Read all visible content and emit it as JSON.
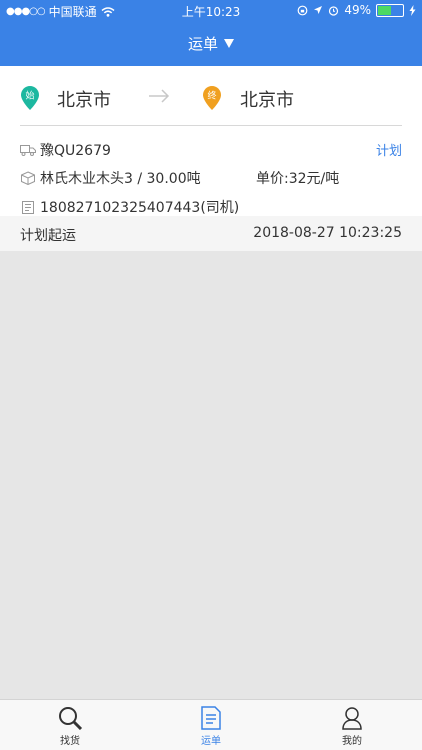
{
  "status": {
    "carrier": "中国联通",
    "time": "上午10:23",
    "battery": "49%",
    "battery_level": 0.49
  },
  "nav": {
    "title": "运单",
    "dropdown_icon": "triangle-down-icon"
  },
  "route": {
    "start_badge": "始",
    "start_city": "北京市",
    "end_badge": "终",
    "end_city": "北京市"
  },
  "order": {
    "plate": "豫QU2679",
    "plan_label": "计划",
    "cargo": "林氏木业木头3 / 30.00吨",
    "unit_price": "单价:32元/吨",
    "driver_id": "180827102325407443(司机)",
    "status_label": "计划起运",
    "datetime": "2018-08-27 10:23:25"
  },
  "tabs": [
    {
      "label": "找货",
      "icon": "search-icon"
    },
    {
      "label": "运单",
      "icon": "document-icon"
    },
    {
      "label": "我的",
      "icon": "user-icon"
    }
  ],
  "colors": {
    "primary": "#3a82e6",
    "start_pin": "#1db8a0",
    "end_pin": "#f0a020"
  }
}
